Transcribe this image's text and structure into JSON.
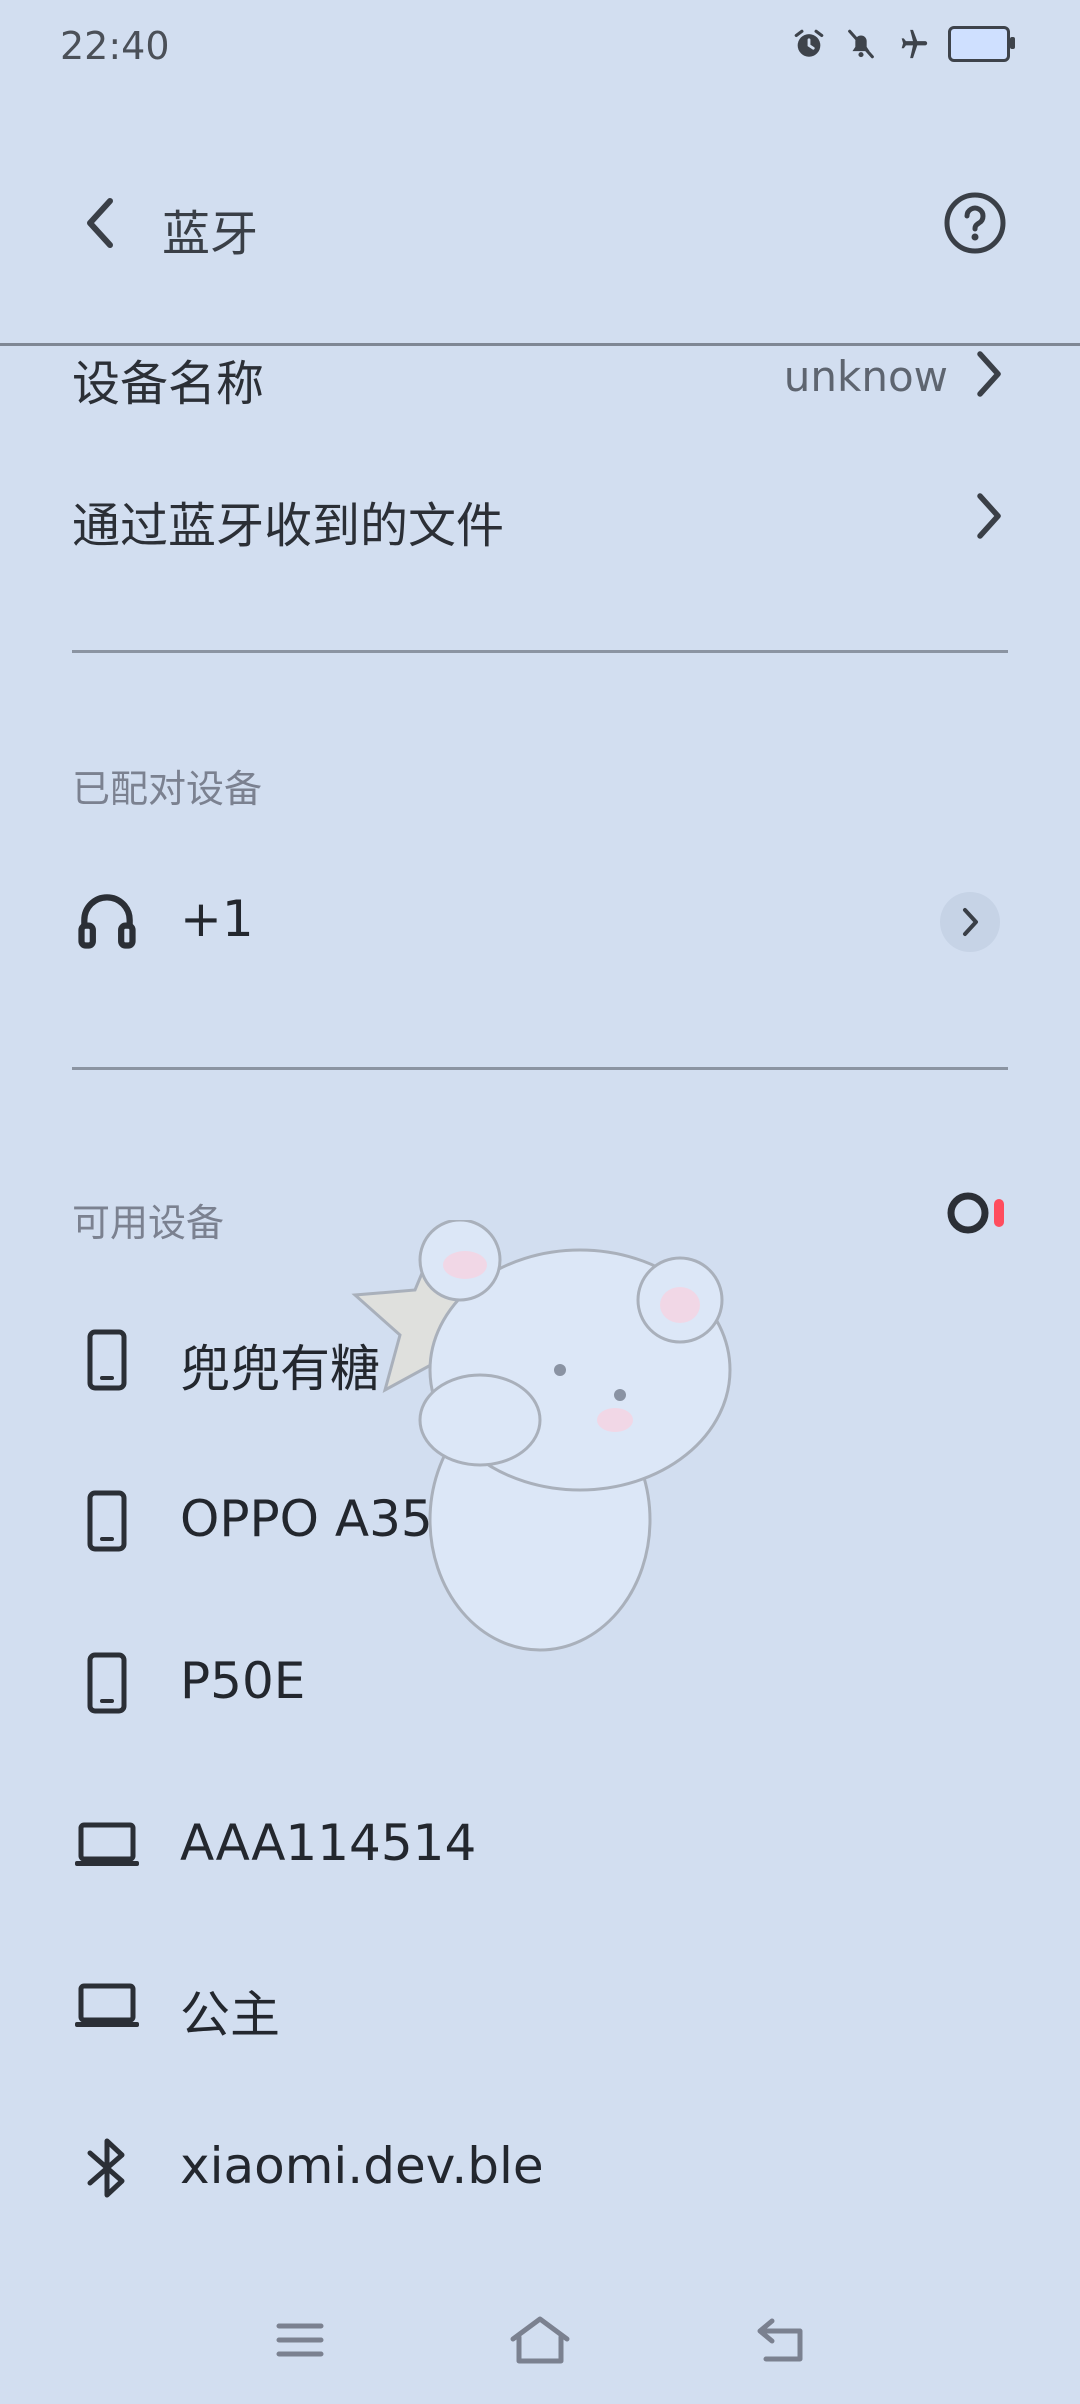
{
  "status_bar": {
    "time": "22:40",
    "icons": [
      "alarm-icon",
      "mute-icon",
      "airplane-mode-icon",
      "battery-icon"
    ]
  },
  "header": {
    "title": "蓝牙",
    "back_icon": "chevron-left-icon",
    "help_icon": "help-circle-icon"
  },
  "settings": {
    "device_name_label": "设备名称",
    "device_name_value": "unknow",
    "received_files_label": "通过蓝牙收到的文件"
  },
  "paired": {
    "section_label": "已配对设备",
    "devices": [
      {
        "name": "+1",
        "icon": "headphones-icon"
      }
    ]
  },
  "available": {
    "section_label": "可用设备",
    "devices": [
      {
        "name": "兜兜有糖",
        "icon": "phone-icon"
      },
      {
        "name": "OPPO A35",
        "icon": "phone-icon"
      },
      {
        "name": "P50E",
        "icon": "phone-icon"
      },
      {
        "name": "AAA114514",
        "icon": "laptop-icon"
      },
      {
        "name": "公主",
        "icon": "laptop-icon"
      },
      {
        "name": "xiaomi.dev.ble",
        "icon": "bluetooth-icon"
      }
    ]
  },
  "nav_bar": {
    "items": [
      "menu-icon",
      "home-icon",
      "back-icon"
    ]
  },
  "colors": {
    "background": "#d2def0",
    "text": "#2b2f36",
    "secondary_text": "#7b8190",
    "accent_red": "#ff4d5e"
  }
}
